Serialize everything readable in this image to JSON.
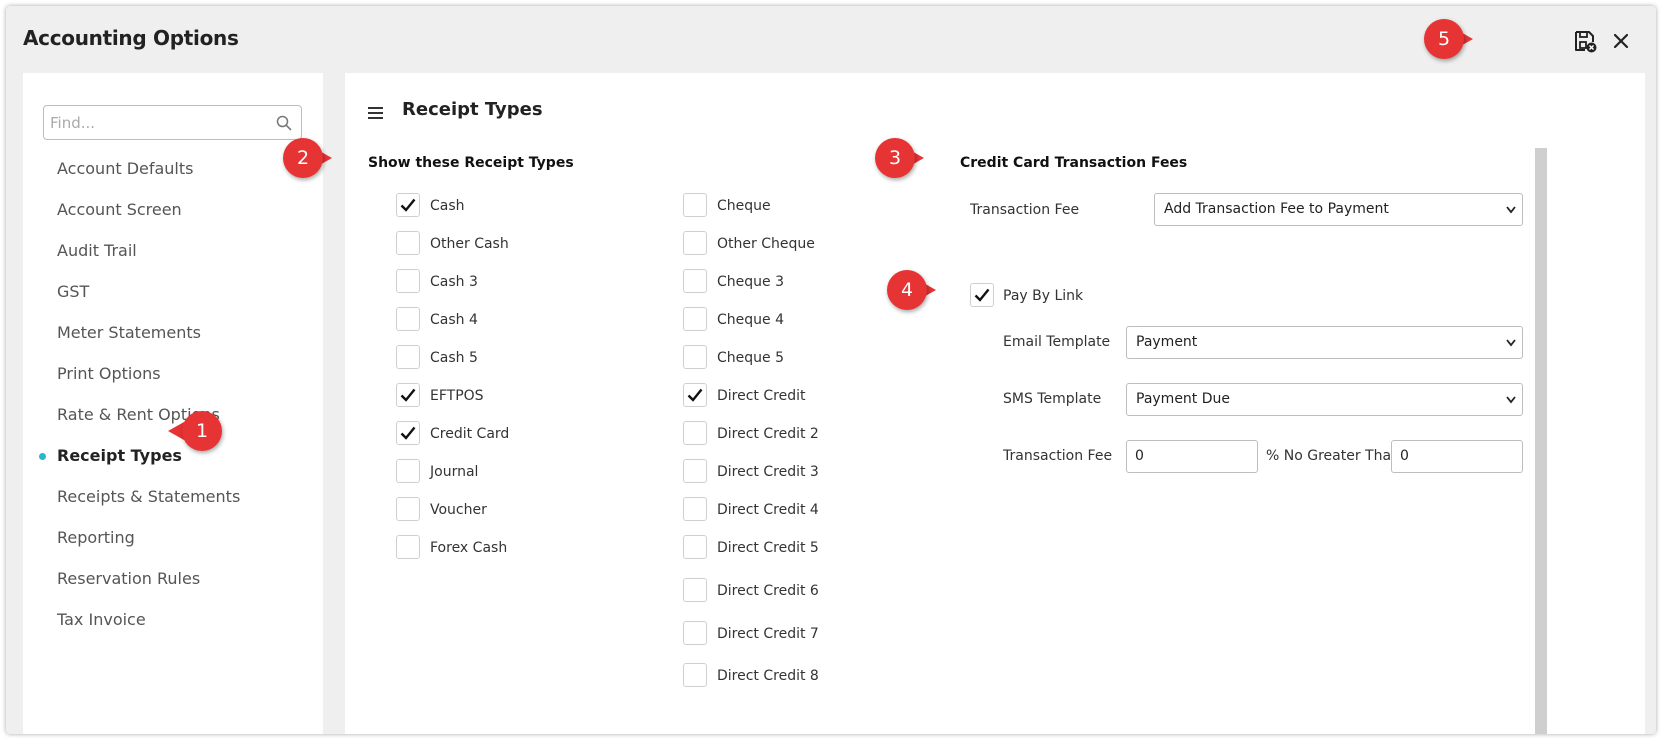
{
  "window": {
    "title": "Accounting Options"
  },
  "sidebar": {
    "search_placeholder": "Find...",
    "items": [
      {
        "label": "Account Defaults"
      },
      {
        "label": "Account Screen"
      },
      {
        "label": "Audit Trail"
      },
      {
        "label": "GST"
      },
      {
        "label": "Meter Statements"
      },
      {
        "label": "Print Options"
      },
      {
        "label": "Rate & Rent Options"
      },
      {
        "label": "Receipt Types",
        "active": true
      },
      {
        "label": "Receipts & Statements"
      },
      {
        "label": "Reporting"
      },
      {
        "label": "Reservation Rules"
      },
      {
        "label": "Tax Invoice"
      }
    ]
  },
  "main": {
    "title": "Receipt Types",
    "receipt_section": {
      "heading": "Show these Receipt Types",
      "col1": [
        {
          "label": "Cash",
          "checked": true
        },
        {
          "label": "Other Cash",
          "checked": false
        },
        {
          "label": "Cash 3",
          "checked": false
        },
        {
          "label": "Cash 4",
          "checked": false
        },
        {
          "label": "Cash 5",
          "checked": false
        },
        {
          "label": "EFTPOS",
          "checked": true
        },
        {
          "label": "Credit Card",
          "checked": true
        },
        {
          "label": "Journal",
          "checked": false
        },
        {
          "label": "Voucher",
          "checked": false
        },
        {
          "label": "Forex Cash",
          "checked": false
        }
      ],
      "col2": [
        {
          "label": "Cheque",
          "checked": false
        },
        {
          "label": "Other Cheque",
          "checked": false
        },
        {
          "label": "Cheque 3",
          "checked": false
        },
        {
          "label": "Cheque 4",
          "checked": false
        },
        {
          "label": "Cheque 5",
          "checked": false
        },
        {
          "label": "Direct Credit",
          "checked": true
        },
        {
          "label": "Direct Credit 2",
          "checked": false
        },
        {
          "label": "Direct Credit 3",
          "checked": false
        },
        {
          "label": "Direct Credit 4",
          "checked": false
        },
        {
          "label": "Direct Credit 5",
          "checked": false
        },
        {
          "label": "Direct Credit 6",
          "checked": false
        },
        {
          "label": "Direct Credit 7",
          "checked": false
        },
        {
          "label": "Direct Credit 8",
          "checked": false
        }
      ]
    },
    "cc_section": {
      "heading": "Credit Card Transaction Fees",
      "transaction_fee_label": "Transaction Fee",
      "transaction_fee_value": "Add Transaction Fee to Payment",
      "pay_by_link_label": "Pay By Link",
      "pay_by_link_checked": true,
      "email_template_label": "Email Template",
      "email_template_value": "Payment",
      "sms_template_label": "SMS Template",
      "sms_template_value": "Payment Due",
      "pbl_fee_label": "Transaction Fee",
      "pbl_fee_value": "0",
      "no_greater_label": "% No Greater Than",
      "no_greater_value": "0"
    }
  },
  "markers": {
    "m1": "1",
    "m2": "2",
    "m3": "3",
    "m4": "4",
    "m5": "5"
  },
  "colors": {
    "marker": "#e63333",
    "active_dot": "#2cb7c7"
  }
}
